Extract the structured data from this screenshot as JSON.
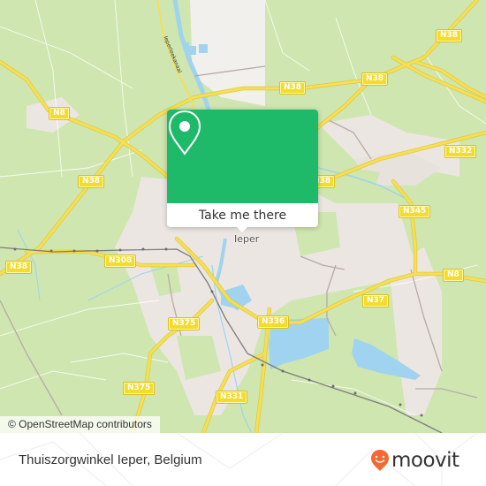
{
  "map": {
    "city_label": "Ieper",
    "canal_label": "Ieperleekanaal",
    "road_labels": [
      {
        "id": "n38-top-right",
        "text": "N38"
      },
      {
        "id": "n38-north",
        "text": "N38"
      },
      {
        "id": "n38-north-center",
        "text": "N38"
      },
      {
        "id": "n8-west",
        "text": "N8"
      },
      {
        "id": "n38-west",
        "text": "N38"
      },
      {
        "id": "n332",
        "text": "N332"
      },
      {
        "id": "n38-hidden",
        "text": "N38"
      },
      {
        "id": "n345",
        "text": "N345"
      },
      {
        "id": "n38-far-west",
        "text": "N38"
      },
      {
        "id": "n308",
        "text": "N308"
      },
      {
        "id": "n8-east",
        "text": "N8"
      },
      {
        "id": "n37",
        "text": "N37"
      },
      {
        "id": "n375-north",
        "text": "N375"
      },
      {
        "id": "n336",
        "text": "N336"
      },
      {
        "id": "n375-south",
        "text": "N375"
      },
      {
        "id": "n331",
        "text": "N331"
      }
    ],
    "colors": {
      "land": "#cfe6b0",
      "urban": "#ece6e2",
      "water": "#9fd3ef",
      "road": "#f2dc4a",
      "rail": "#8a8a8a"
    }
  },
  "popup": {
    "icon": "map-pin-icon",
    "button_label": "Take me there",
    "accent_color": "#1fb96a"
  },
  "attribution": "© OpenStreetMap contributors",
  "footer": {
    "place_name": "Thuiszorgwinkel Ieper, Belgium",
    "brand": "moovit",
    "brand_color": "#f26a32"
  }
}
